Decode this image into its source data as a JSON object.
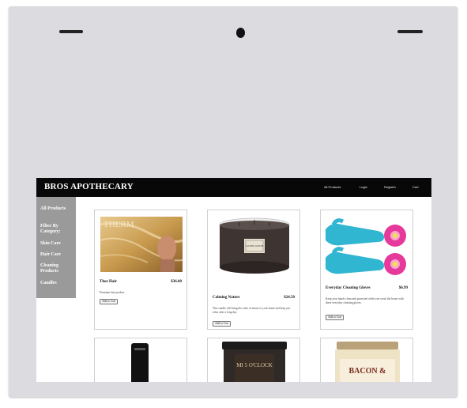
{
  "store": {
    "brand": "BROS APOTHECARY",
    "nav_links": [
      "All Products",
      "Login",
      "Register",
      "Cart"
    ]
  },
  "sidebar": {
    "items": [
      {
        "label": "All Products"
      },
      {
        "label": "Filter By Category:"
      },
      {
        "label": "Skin Care"
      },
      {
        "label": "Hair Care"
      },
      {
        "label": "Cleaning Products"
      },
      {
        "label": "Candles"
      }
    ]
  },
  "products": [
    {
      "name": "Thor Hair",
      "price": "$36.00",
      "image_text": "THERM",
      "description": "Premium hair product",
      "button": "Add to Cart"
    },
    {
      "name": "Calming Nature",
      "price": "$24.50",
      "image_text": "CALMING NATURE",
      "description": "This candle will bring the calm of nature to your home and help you relax after a long day",
      "button": "Add to Cart"
    },
    {
      "name": "Everyday Cleaning Gloves",
      "price": "$6.99",
      "image_text": "",
      "description": "Keep your hands clean and protected while you scrub the house with these everyday cleaning gloves.",
      "button": "Add to Cart"
    },
    {
      "name": "",
      "price": "",
      "image_text": "",
      "description": "",
      "button": ""
    },
    {
      "name": "",
      "price": "",
      "image_text": "MI 5 O'CLOCK",
      "description": "",
      "button": ""
    },
    {
      "name": "",
      "price": "",
      "image_text": "BACON &",
      "description": "",
      "button": ""
    }
  ],
  "colors": {
    "navbar": "#080808",
    "sidebar": "#9a9a9a",
    "glove": "#31b6d2",
    "flower": "#e5399b"
  }
}
